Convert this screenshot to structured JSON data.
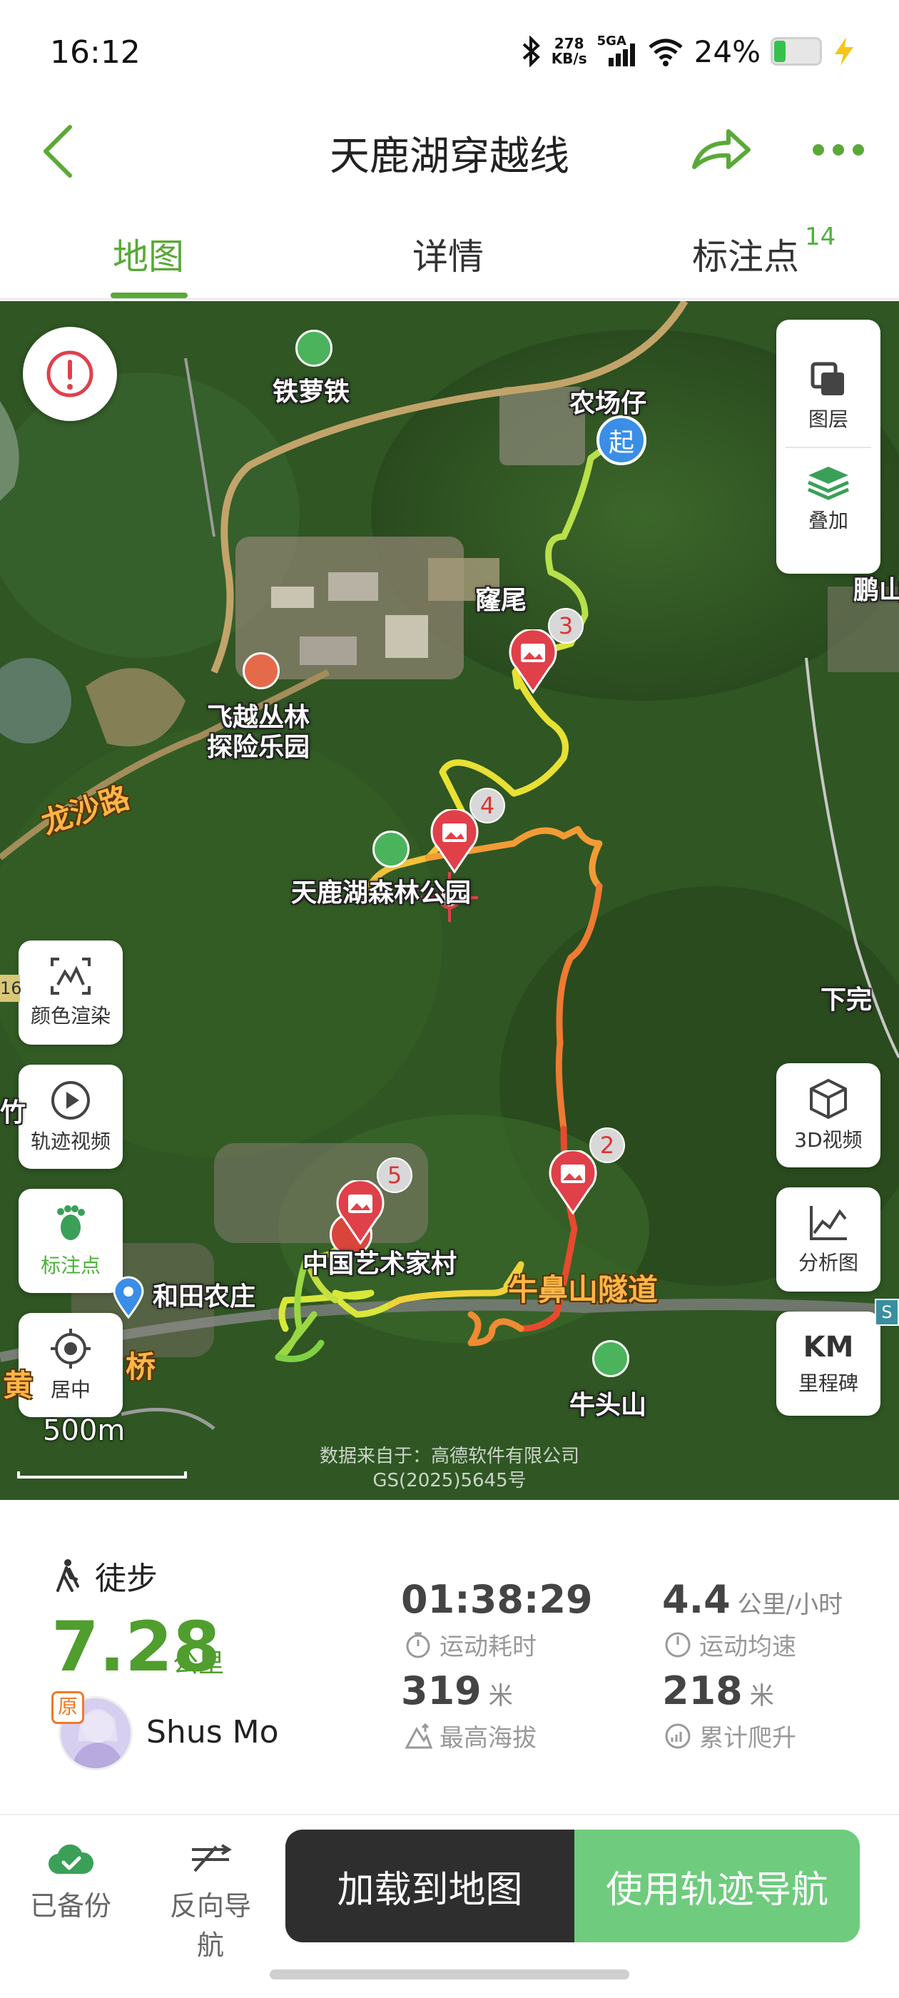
{
  "status_bar": {
    "time": "16:12",
    "net_speed_value": "278",
    "net_speed_unit": "KB/s",
    "signal": "5GA",
    "battery_percent": "24%",
    "battery_level": 0.24
  },
  "header": {
    "title": "天鹿湖穿越线"
  },
  "tabs": [
    {
      "label": "地图",
      "active": true
    },
    {
      "label": "详情",
      "active": false
    },
    {
      "label": "标注点",
      "badge": "14",
      "active": false
    }
  ],
  "map": {
    "right_controls": {
      "layers": "图层",
      "overlay": "叠加",
      "video_3d": "3D视频",
      "analysis": "分析图",
      "milestone_icon": "KM",
      "milestone": "里程碑"
    },
    "left_controls": {
      "color_render": "颜色渲染",
      "track_video": "轨迹视频",
      "markers": "标注点",
      "center": "居中"
    },
    "start_marker": "起",
    "place_labels": {
      "tieluotie": "铁萝铁",
      "nongchangzai": "农场仔",
      "pengshan": "鹏山",
      "longwei": "窿尾",
      "feiyue_line1": "飞越丛林",
      "feiyue_line2": "探险乐园",
      "longsha_road": "龙沙路",
      "tianluhu_park": "天鹿湖森林公园",
      "xiawan": "下完",
      "zhongguo_art_village": "中国艺术家村",
      "hetian_farm": "和田农庄",
      "bizishan_tunnel": "牛鼻山隧道",
      "niutoushan": "牛头山",
      "left_road_fragment": "黄",
      "left_bridge_fragment": "桥",
      "left_edge_16": "16",
      "left_edge_zhu": "竹",
      "right_edge_s": "S"
    },
    "photo_markers": [
      "2",
      "3",
      "4",
      "5"
    ],
    "scale": "500m",
    "attribution_line1": "数据来自于：高德软件有限公司",
    "attribution_line2": "GS(2025)5645号"
  },
  "stats": {
    "activity": "徒步",
    "distance": "7.28",
    "distance_unit": "公里",
    "author_badge": "原",
    "username": "Shus Mo",
    "duration": "01:38:29",
    "duration_label": "运动耗时",
    "avg_speed": "4.4",
    "avg_speed_unit": "公里/小时",
    "avg_speed_label": "运动均速",
    "max_altitude": "319",
    "max_altitude_unit": "米",
    "max_altitude_label": "最高海拔",
    "total_climb": "218",
    "total_climb_unit": "米",
    "total_climb_label": "累计爬升"
  },
  "bottom_bar": {
    "backup": "已备份",
    "reverse_nav": "反向导航",
    "load_to_map": "加载到地图",
    "use_track_nav": "使用轨迹导航"
  },
  "colors": {
    "brand_green": "#5aa938",
    "nav_button_green": "#6fcb7e",
    "dark_button": "#2e2e2e",
    "marker_red": "#e0404a"
  }
}
